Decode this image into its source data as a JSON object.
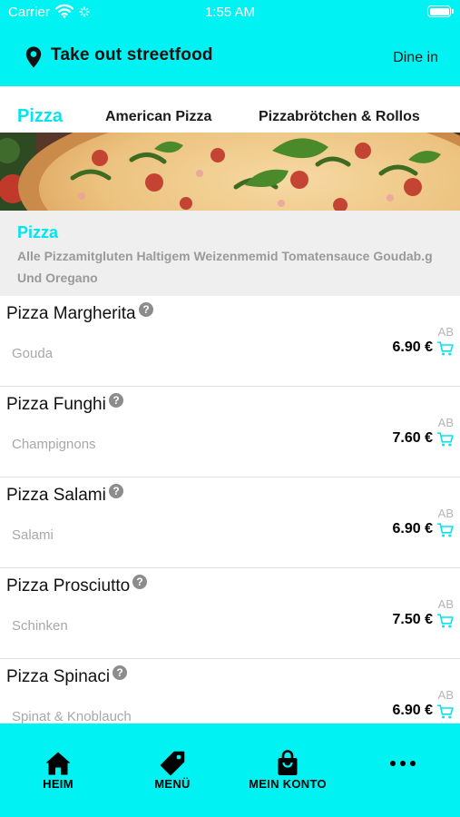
{
  "status_bar": {
    "carrier": "Carrier",
    "time": "1:55 AM"
  },
  "header": {
    "location_icon": "map-pin-icon",
    "title": "Take out streetfood",
    "mode_toggle": "Dine in",
    "accent_color": "#00f2f2"
  },
  "category_tabs": [
    {
      "label": "Pizza",
      "active": true
    },
    {
      "label": "American Pizza",
      "active": false
    },
    {
      "label": "Pizzabrötchen & Rollos",
      "active": false
    }
  ],
  "category_info": {
    "title": "Pizza",
    "description": "Alle Pizzamitgluten Haltigem Weizenmemid Tomatensauce Goudab.g Und Oregano"
  },
  "menu_items": [
    {
      "name": "Pizza Margherita",
      "description": "Gouda",
      "price_prefix": "AB",
      "price": "6.90 €"
    },
    {
      "name": "Pizza Funghi",
      "description": "Champignons",
      "price_prefix": "AB",
      "price": "7.60 €"
    },
    {
      "name": "Pizza Salami",
      "description": "Salami",
      "price_prefix": "AB",
      "price": "6.90 €"
    },
    {
      "name": "Pizza Prosciutto",
      "description": "Schinken",
      "price_prefix": "AB",
      "price": "7.50 €"
    },
    {
      "name": "Pizza Spinaci",
      "description": "Spinat & Knoblauch",
      "price_prefix": "AB",
      "price": "6.90 €"
    }
  ],
  "bottom_nav": [
    {
      "label": "HEIM",
      "icon": "home-icon"
    },
    {
      "label": "MENÜ",
      "icon": "tag-icon"
    },
    {
      "label": "MEIN KONTO",
      "icon": "shopping-bag-icon"
    },
    {
      "label": "",
      "icon": "more-icon"
    }
  ]
}
